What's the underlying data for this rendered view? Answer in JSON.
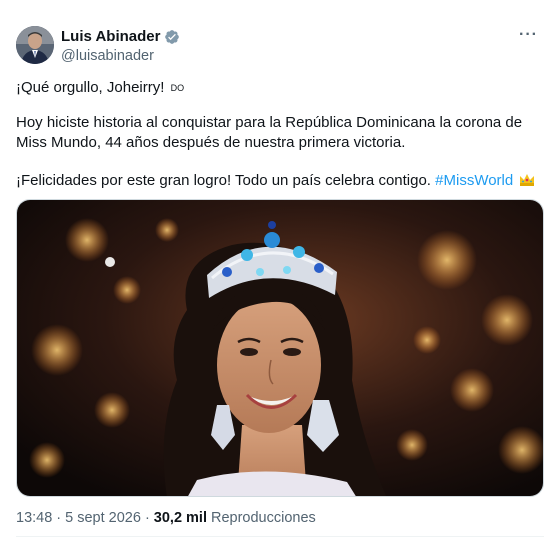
{
  "author": {
    "name": "Luis Abinader",
    "handle": "@luisabinader",
    "verified_color": "#829aab"
  },
  "tweet": {
    "line1": "¡Qué orgullo, Joheirry!",
    "line1_flag": "DO",
    "paragraph2": "Hoy hiciste historia al conquistar para la República Dominicana la corona de Miss Mundo, 44 años después de nuestra primera victoria.",
    "line3": "¡Felicidades por este gran logro! Todo un país celebra contigo.",
    "hashtag": "#MissWorld",
    "crown_icon": "crown-emoji"
  },
  "meta": {
    "time": "13:48",
    "separator": "·",
    "date": "5 sept 2026",
    "views_count": "30,2 mil",
    "views_label": "Reproducciones"
  },
  "menu": {
    "more_label": "···"
  },
  "colors": {
    "link": "#1d9bf0",
    "secondary": "#536471",
    "text": "#0f1419"
  }
}
